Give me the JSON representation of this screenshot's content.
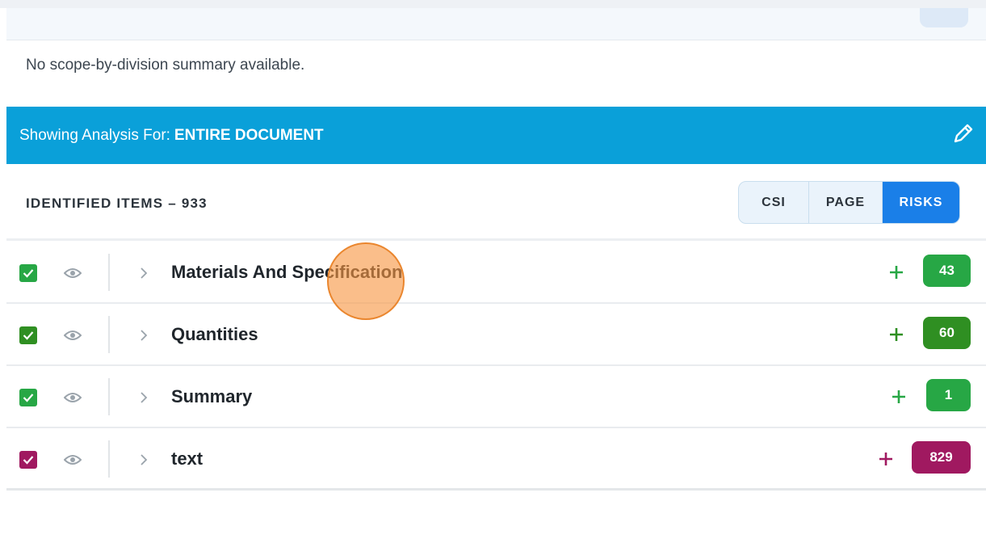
{
  "summary": {
    "message": "No scope-by-division summary available."
  },
  "analysis": {
    "label": "Showing Analysis For:",
    "scope": "ENTIRE DOCUMENT",
    "edit_icon": "pencil-icon"
  },
  "items_header": {
    "title": "IDENTIFIED ITEMS – 933"
  },
  "view_toggle": {
    "options": [
      "CSI",
      "PAGE",
      "RISKS"
    ],
    "selected": "RISKS"
  },
  "colors": {
    "banner": "#0aa0d9",
    "selected_segment": "#1a7fe8",
    "green": "#27a745",
    "green_dark": "#2f8f22",
    "magenta": "#a01960"
  },
  "items": [
    {
      "label": "Materials And Specification",
      "count": "43",
      "color": "#27a745",
      "checked": true,
      "icons": [
        "checkbox-icon",
        "eye-icon",
        "chevron-right-icon",
        "plus-icon"
      ]
    },
    {
      "label": "Quantities",
      "count": "60",
      "color": "#2f8f22",
      "checked": true,
      "icons": [
        "checkbox-icon",
        "eye-icon",
        "chevron-right-icon",
        "plus-icon"
      ]
    },
    {
      "label": "Summary",
      "count": "1",
      "color": "#27a745",
      "checked": true,
      "icons": [
        "checkbox-icon",
        "eye-icon",
        "chevron-right-icon",
        "plus-icon"
      ]
    },
    {
      "label": "text",
      "count": "829",
      "color": "#a01960",
      "checked": true,
      "icons": [
        "checkbox-icon",
        "eye-icon",
        "chevron-right-icon",
        "plus-icon"
      ]
    }
  ]
}
